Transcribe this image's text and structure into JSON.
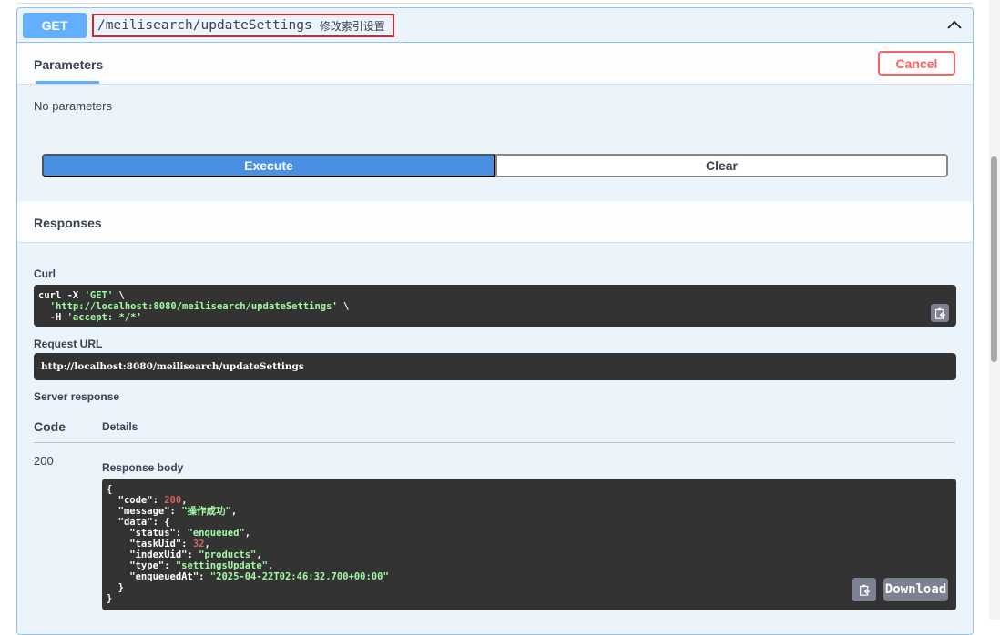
{
  "operation": {
    "method": "GET",
    "path": "/meilisearch/updateSettings",
    "description": "修改索引设置"
  },
  "parameters": {
    "tab_label": "Parameters",
    "cancel_label": "Cancel",
    "empty_text": "No parameters"
  },
  "actions": {
    "execute_label": "Execute",
    "clear_label": "Clear"
  },
  "responses": {
    "title": "Responses",
    "curl_label": "Curl",
    "curl": {
      "l1a": "curl -X ",
      "l1b": "'GET'",
      "l1c": " \\",
      "l2a": "  ",
      "l2b": "'http://localhost:8080/meilisearch/updateSettings'",
      "l2c": " \\",
      "l3a": "  -H ",
      "l3b": "'accept: */*'"
    },
    "request_url_label": "Request URL",
    "request_url": "http://localhost:8080/meilisearch/updateSettings",
    "server_response_label": "Server response",
    "code_header": "Code",
    "details_header": "Details",
    "status_code": "200",
    "body_label": "Response body",
    "body": {
      "open": "{",
      "code_key": "  \"code\": ",
      "code_val": "200",
      "message_key": "  \"message\": ",
      "message_val": "\"操作成功\"",
      "data_key": "  \"data\": {",
      "status_key": "    \"status\": ",
      "status_val": "\"enqueued\"",
      "task_key": "    \"taskUid\": ",
      "task_val": "32",
      "index_key": "    \"indexUid\": ",
      "index_val": "\"products\"",
      "type_key": "    \"type\": ",
      "type_val": "\"settingsUpdate\"",
      "enq_key": "    \"enqueuedAt\": ",
      "enq_val": "\"2025-04-22T02:46:32.700+00:00\"",
      "data_close": "  }",
      "close": "}"
    },
    "download_label": "Download"
  },
  "colors": {
    "get": "#61affe",
    "cancel": "#ff6060",
    "execute": "#4990e2"
  }
}
